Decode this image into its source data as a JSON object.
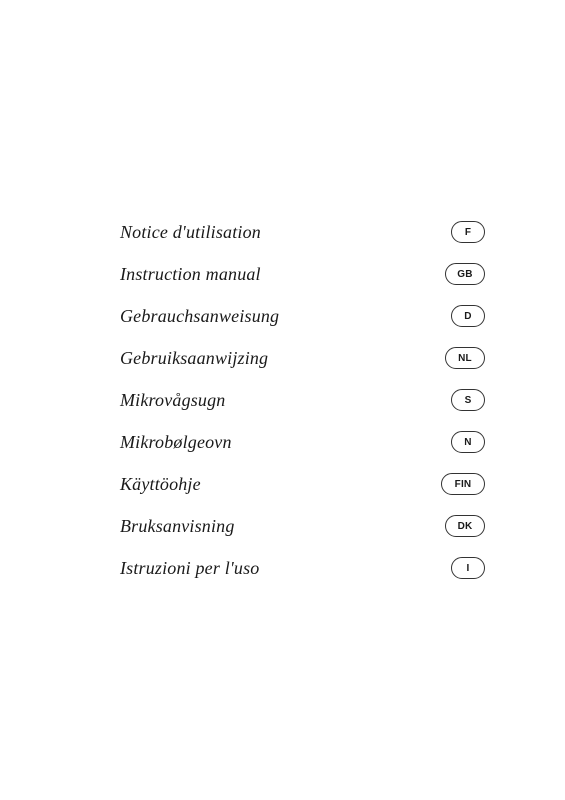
{
  "manuals": [
    {
      "label": "Notice d'utilisation",
      "code": "F",
      "wide": false
    },
    {
      "label": "Instruction manual",
      "code": "GB",
      "wide": true
    },
    {
      "label": "Gebrauchsanweisung",
      "code": "D",
      "wide": false
    },
    {
      "label": "Gebruiksaanwijzing",
      "code": "NL",
      "wide": true
    },
    {
      "label": "Mikrovågsugn",
      "code": "S",
      "wide": false
    },
    {
      "label": "Mikrobølgeovn",
      "code": "N",
      "wide": false
    },
    {
      "label": "Käyttöohje",
      "code": "FIN",
      "wide": true
    },
    {
      "label": "Bruksanvisning",
      "code": "DK",
      "wide": true
    },
    {
      "label": "Istruzioni per l'uso",
      "code": "I",
      "wide": false
    }
  ]
}
